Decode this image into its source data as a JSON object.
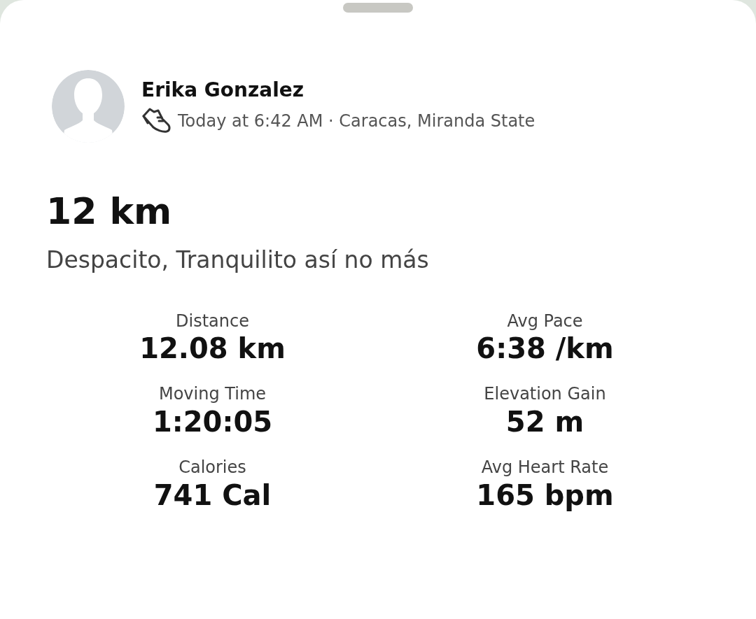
{
  "athlete": {
    "name": "Erika Gonzalez",
    "meta": "Today at 6:42 AM · Caracas, Miranda State"
  },
  "activity": {
    "title": "12 km",
    "description": "Despacito, Tranquilito así no más"
  },
  "stats": [
    {
      "label": "Distance",
      "value": "12.08 km"
    },
    {
      "label": "Avg Pace",
      "value": "6:38 /km"
    },
    {
      "label": "Moving Time",
      "value": "1:20:05"
    },
    {
      "label": "Elevation Gain",
      "value": "52 m"
    },
    {
      "label": "Calories",
      "value": "741 Cal"
    },
    {
      "label": "Avg Heart Rate",
      "value": "165 bpm"
    }
  ]
}
